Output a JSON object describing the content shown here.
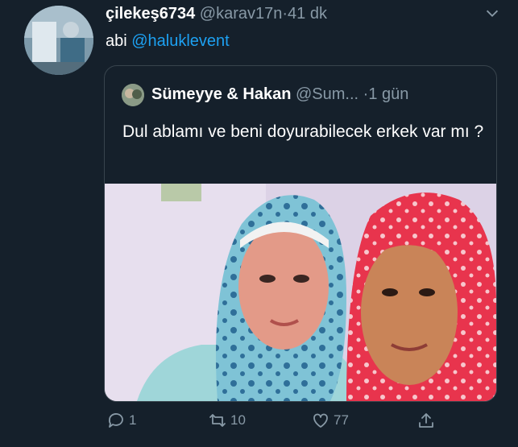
{
  "tweet": {
    "display_name": "çilekeş6734",
    "handle": "@karav17n",
    "separator": "·",
    "time": "41 dk",
    "text_prefix": "abi ",
    "mention": "@haluklevent"
  },
  "quoted": {
    "display_name": "Sümeyye & Hakan",
    "handle": "@Sum...",
    "separator": "·",
    "time": "1 gün",
    "text": "Dul ablamı ve beni doyurabilecek erkek var mı ?"
  },
  "actions": {
    "reply_count": "1",
    "retweet_count": "10",
    "like_count": "77"
  },
  "colors": {
    "background": "#15202b",
    "link": "#1da1f2",
    "muted": "#8899a6",
    "border": "#38444d"
  },
  "icons": [
    "chevron-down-icon",
    "reply-icon",
    "retweet-icon",
    "like-icon",
    "share-icon"
  ]
}
